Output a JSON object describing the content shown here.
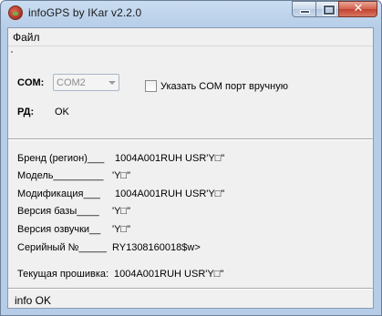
{
  "window": {
    "title": "infoGPS  by IKar v2.2.0"
  },
  "menu": {
    "file": "Файл"
  },
  "connection": {
    "com_label": "COM:",
    "com_value": "COM2",
    "manual_checkbox_label": "Указать COM  порт вручную",
    "manual_checked": false,
    "rd_label": "РД:",
    "rd_value": "OK"
  },
  "info": {
    "rows": [
      {
        "label": "Бренд (регион)___",
        "value": "1004A001RUH  USR'Y□\""
      },
      {
        "label": "Модель_________",
        "value": "'Y□\""
      },
      {
        "label": "Модификация___",
        "value": "1004A001RUH  USR'Y□\""
      },
      {
        "label": "Версия базы____",
        "value": "'Y□\""
      },
      {
        "label": "Версия озвучки__",
        "value": "'Y□\""
      },
      {
        "label": "Серийный №_____",
        "value": "RY1308160018$w>"
      }
    ],
    "firmware_label": "Текущая прошивка:",
    "firmware_value": "1004A001RUH  USR'Y□\""
  },
  "status": {
    "text": "info OK"
  }
}
